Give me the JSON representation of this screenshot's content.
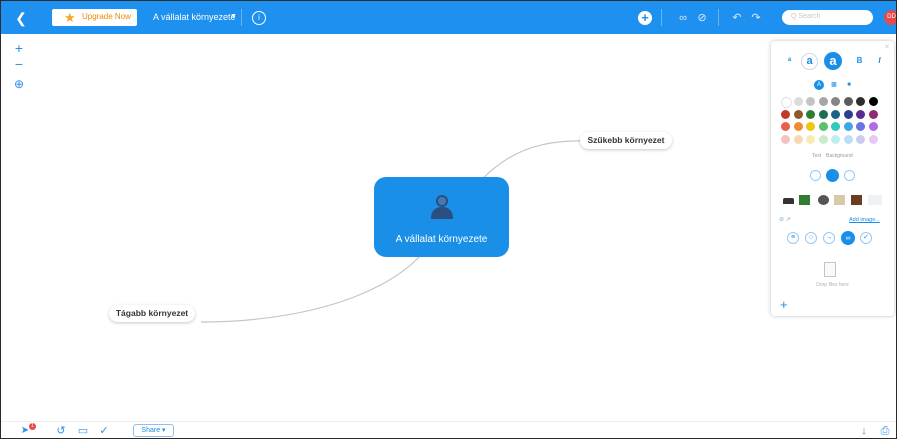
{
  "topbar": {
    "upgrade_label": "Upgrade Now",
    "document_title": "A vállalat környezete",
    "search_placeholder": "Q Search",
    "avatar_initials": "DD"
  },
  "mindmap": {
    "root_label": "A vállalat környezete",
    "branches": [
      {
        "label": "Szűkebb környezet"
      },
      {
        "label": "Tágabb környezet"
      }
    ]
  },
  "panel": {
    "font_buttons": [
      "a",
      "a",
      "a",
      "B",
      "I"
    ],
    "text_label": "Text",
    "background_label": "Background",
    "swatches": [
      [
        "#ffffff",
        "#dcdcdc",
        "#c4c4c4",
        "#a6a6a6",
        "#858585",
        "#5c5c5c",
        "#2e2e2e",
        "#000000"
      ],
      [
        "#c0392b",
        "#8e5a2b",
        "#2e7d32",
        "#1b6f54",
        "#1f5f8b",
        "#2c3e8f",
        "#5b2c8f",
        "#8e2c6f"
      ],
      [
        "#e8604c",
        "#f08c34",
        "#f1c40f",
        "#5cc16a",
        "#31c9c0",
        "#3fa7e8",
        "#6a73e8",
        "#b26ae8"
      ],
      [
        "#f4c2c2",
        "#f7d8b2",
        "#f7ecb2",
        "#c8ecc8",
        "#bfeeee",
        "#bcdcf7",
        "#ccccf2",
        "#e6c8f2"
      ]
    ],
    "add_image_label": "Add image...",
    "drop_label": "Drop files here"
  },
  "bottombar": {
    "notification_count": "1",
    "share_label": "Share ▾"
  },
  "colors": {
    "accent": "#1e90f0",
    "root_fill": "#1a8fe8",
    "connector": "#c6c6c6",
    "upgrade_text": "#f08a00"
  }
}
